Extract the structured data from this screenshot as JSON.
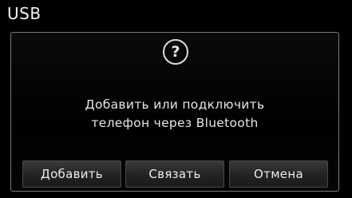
{
  "header": {
    "title": "USB"
  },
  "dialog": {
    "icon": "question-icon",
    "icon_glyph": "?",
    "message_line1": "Добавить или подключить",
    "message_line2": "телефон через Bluetooth",
    "buttons": {
      "add_label": "Добавить",
      "pair_label": "Связать",
      "cancel_label": "Отмена"
    }
  },
  "colors": {
    "background": "#000000",
    "text": "#e6e6e6",
    "dialog_border": "#7a7a7a",
    "button_top": "#3a3a3a",
    "button_bottom": "#1b1b1b"
  }
}
